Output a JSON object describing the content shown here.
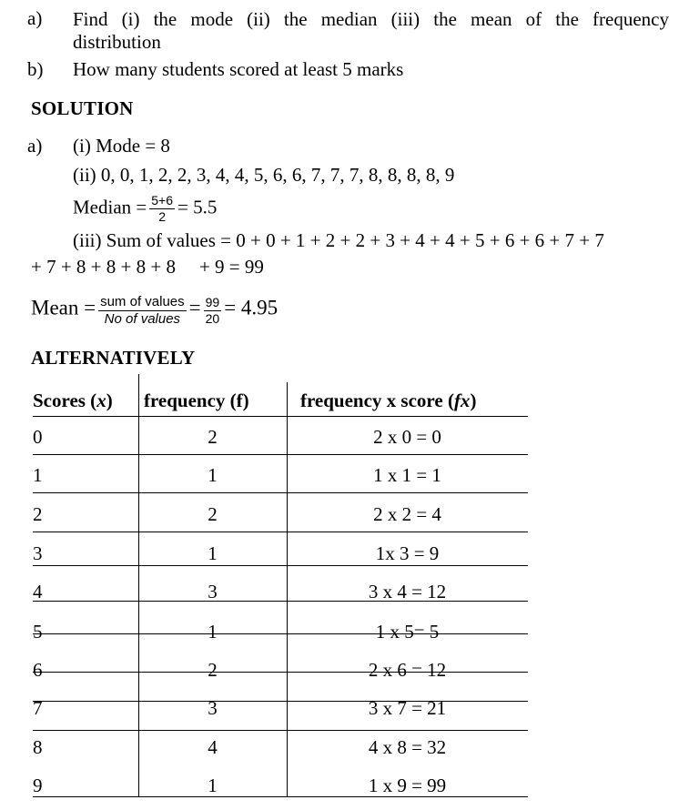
{
  "questions": [
    {
      "marker": "a)",
      "line1": "Find  (i) the mode  (ii) the median  (iii) the mean of the frequency",
      "line2": "distribution"
    },
    {
      "marker": "b)",
      "line1": "How many students scored at least 5 marks"
    }
  ],
  "solution_heading": "SOLUTION",
  "solution": {
    "marker": "a)",
    "part_i": "(i)  Mode = 8",
    "part_ii": "(ii)  0, 0, 1, 2, 2, 3, 4, 4, 5, 6, 6, 7, 7, 7, 8, 8, 8, 8, 9",
    "median": {
      "label": "Median =",
      "numerator": "5+6",
      "denominator": "2",
      "result": "= 5.5"
    },
    "part_iii_line1": "(iii)  Sum of values = 0 + 0 + 1 + 2 + 2 + 3 + 4 + 4 + 5 + 6 + 6 + 7 + 7",
    "part_iii_line2": "+ 7 + 8 + 8 + 8 + 8",
    "part_iii_line2b": "+ 9 = 99"
  },
  "mean": {
    "label": "Mean =",
    "numerator": "sum of values",
    "denominator": "No of values",
    "equals1": "=",
    "numerator2": "99",
    "denominator2": "20",
    "result": "= 4.95"
  },
  "alternatively_heading": "ALTERNATIVELY",
  "table": {
    "headers": {
      "col0_text": "Scores (",
      "col0_var": "x",
      "col0_close": ")",
      "col1": "frequency (f)",
      "col2_text": "frequency x score (",
      "col2_var": "fx",
      "col2_close": ")"
    },
    "rows": [
      {
        "score": "0",
        "frequency": "2",
        "product": "2 x 0 = 0"
      },
      {
        "score": "1",
        "frequency": "1",
        "product": "1 x 1 = 1"
      },
      {
        "score": "2",
        "frequency": "2",
        "product": "2 x 2 = 4"
      },
      {
        "score": "3",
        "frequency": "1",
        "product": "1x 3 = 9"
      },
      {
        "score": "4",
        "frequency": "3",
        "product": "3 x 4 = 12"
      },
      {
        "score": "5",
        "frequency": "1",
        "product": "1 x 5= 5"
      },
      {
        "score": "6",
        "frequency": "2",
        "product": "2 x 6 = 12"
      },
      {
        "score": "7",
        "frequency": "3",
        "product": "3 x 7 = 21"
      },
      {
        "score": "8",
        "frequency": "4",
        "product": "4 x 8 = 32"
      },
      {
        "score": "9",
        "frequency": "1",
        "product": "1 x 9 = 99"
      }
    ]
  },
  "colors": {
    "text": "#000000",
    "background": "#ffffff",
    "rule": "#000000"
  }
}
